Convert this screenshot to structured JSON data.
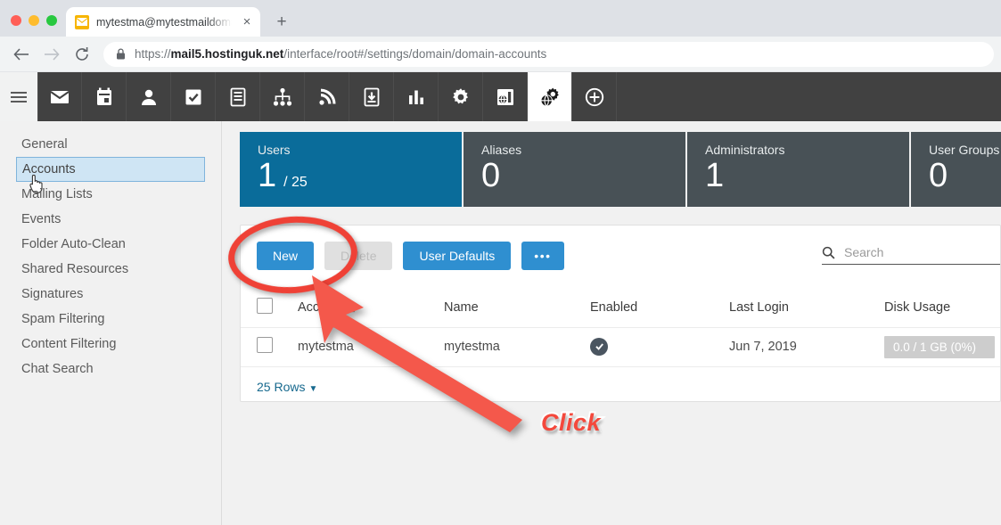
{
  "browser": {
    "tab": {
      "title": "mytestma@mytestmaildomain.c",
      "favicon": "envelope-icon",
      "close": "×"
    },
    "new_tab_label": "+",
    "back_label": "←",
    "forward_label": "→",
    "reload_label": "⟳",
    "url": {
      "scheme": "https://",
      "host": "mail5.hostinguk.net",
      "path": "/interface/root#/settings/domain/domain-accounts"
    }
  },
  "appnav": {
    "menu": "hamburger-icon",
    "items": [
      {
        "name": "mail-icon",
        "active": false
      },
      {
        "name": "calendar-icon",
        "active": false
      },
      {
        "name": "contacts-icon",
        "active": false
      },
      {
        "name": "tasks-icon",
        "active": false
      },
      {
        "name": "notes-icon",
        "active": false
      },
      {
        "name": "org-chart-icon",
        "active": false
      },
      {
        "name": "rss-feeds-icon",
        "active": false
      },
      {
        "name": "file-storage-icon",
        "active": false
      },
      {
        "name": "reports-icon",
        "active": false
      },
      {
        "name": "settings-gear-icon",
        "active": false
      },
      {
        "name": "domain-settings-icon",
        "active": false
      },
      {
        "name": "domain-admin-icon",
        "active": true
      },
      {
        "name": "add-icon",
        "active": false
      }
    ]
  },
  "sidebar": {
    "items": [
      {
        "label": "General",
        "selected": false
      },
      {
        "label": "Accounts",
        "selected": true
      },
      {
        "label": "Mailing Lists",
        "selected": false
      },
      {
        "label": "Events",
        "selected": false
      },
      {
        "label": "Folder Auto-Clean",
        "selected": false
      },
      {
        "label": "Shared Resources",
        "selected": false
      },
      {
        "label": "Signatures",
        "selected": false
      },
      {
        "label": "Spam Filtering",
        "selected": false
      },
      {
        "label": "Content Filtering",
        "selected": false
      },
      {
        "label": "Chat Search",
        "selected": false
      }
    ]
  },
  "stats": [
    {
      "label": "Users",
      "value": "1",
      "total": "/ 25",
      "primary": true
    },
    {
      "label": "Aliases",
      "value": "0",
      "total": "",
      "primary": false
    },
    {
      "label": "Administrators",
      "value": "1",
      "total": "",
      "primary": false
    },
    {
      "label": "User Groups",
      "value": "0",
      "total": "",
      "primary": false
    }
  ],
  "toolbar": {
    "new_label": "New",
    "delete_label": "Delete",
    "user_defaults_label": "User Defaults",
    "more_label": "•••"
  },
  "search": {
    "placeholder": "Search",
    "value": ""
  },
  "table": {
    "columns": [
      "Account",
      "Name",
      "Enabled",
      "Last Login",
      "Disk Usage"
    ],
    "sort_indicator": "△",
    "rows": [
      {
        "account": "mytestma",
        "name": "mytestma",
        "enabled": true,
        "last_login": "Jun 7, 2019",
        "disk_usage": "0.0 / 1 GB (0%)"
      }
    ],
    "rows_per_page": "25 Rows",
    "rows_caret": "▼"
  },
  "annotations": {
    "click_label": "Click",
    "ellipse_color": "#ef4136",
    "arrow_color": "#f4584b"
  },
  "colors": {
    "accent_blue": "#2f8fd0",
    "card_primary": "#0a6c9a",
    "card_dark": "#485156",
    "nav_dark": "#414141",
    "link": "#17698e"
  }
}
